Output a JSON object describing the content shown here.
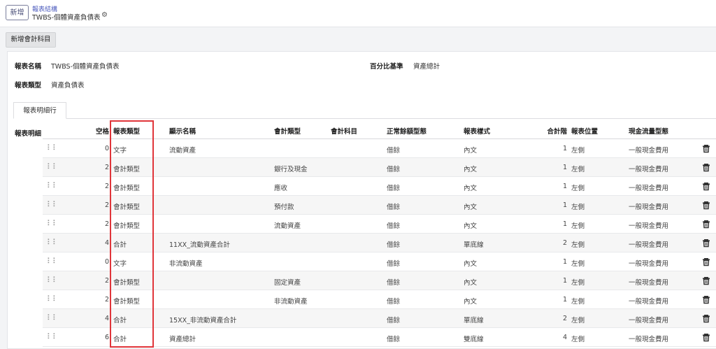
{
  "header": {
    "new_button": "新增",
    "breadcrumb": "報表結構",
    "subtitle": "TWBS-個體資產負債表"
  },
  "toolbar": {
    "add_account_button": "新增會計科目"
  },
  "form": {
    "report_name_label": "報表名稱",
    "report_name_value": "TWBS-個體資產負債表",
    "percent_base_label": "百分比基準",
    "percent_base_value": "資產總計",
    "report_type_label": "報表類型",
    "report_type_value": "資產負債表"
  },
  "tabs": [
    {
      "label": "報表明細行"
    }
  ],
  "detail_label": "報表明細",
  "columns": {
    "indent": "空格",
    "report_type": "報表類型",
    "display_name": "顯示名稱",
    "account_type": "會計類型",
    "account": "會計科目",
    "normal_balance": "正常餘額型態",
    "report_style": "報表樣式",
    "total_level": "合計階",
    "report_position": "報表位置",
    "cashflow_type": "現金流量型態"
  },
  "rows": [
    {
      "indent": "0",
      "report_type": "文字",
      "display_name": "流動資產",
      "account_type": "",
      "account": "",
      "normal_balance": "借餘",
      "report_style": "內文",
      "total_level": "1",
      "report_position": "左側",
      "cashflow_type": "一般現金費用"
    },
    {
      "indent": "2",
      "report_type": "會計類型",
      "display_name": "",
      "account_type": "銀行及現金",
      "account": "",
      "normal_balance": "借餘",
      "report_style": "內文",
      "total_level": "1",
      "report_position": "左側",
      "cashflow_type": "一般現金費用"
    },
    {
      "indent": "2",
      "report_type": "會計類型",
      "display_name": "",
      "account_type": "應收",
      "account": "",
      "normal_balance": "借餘",
      "report_style": "內文",
      "total_level": "1",
      "report_position": "左側",
      "cashflow_type": "一般現金費用"
    },
    {
      "indent": "2",
      "report_type": "會計類型",
      "display_name": "",
      "account_type": "預付款",
      "account": "",
      "normal_balance": "借餘",
      "report_style": "內文",
      "total_level": "1",
      "report_position": "左側",
      "cashflow_type": "一般現金費用"
    },
    {
      "indent": "2",
      "report_type": "會計類型",
      "display_name": "",
      "account_type": "流動資產",
      "account": "",
      "normal_balance": "借餘",
      "report_style": "內文",
      "total_level": "1",
      "report_position": "左側",
      "cashflow_type": "一般現金費用"
    },
    {
      "indent": "4",
      "report_type": "合計",
      "display_name": "11XX_流動資產合計",
      "account_type": "",
      "account": "",
      "normal_balance": "借餘",
      "report_style": "單底線",
      "total_level": "2",
      "report_position": "左側",
      "cashflow_type": "一般現金費用"
    },
    {
      "indent": "0",
      "report_type": "文字",
      "display_name": "非流動資產",
      "account_type": "",
      "account": "",
      "normal_balance": "借餘",
      "report_style": "內文",
      "total_level": "1",
      "report_position": "左側",
      "cashflow_type": "一般現金費用"
    },
    {
      "indent": "2",
      "report_type": "會計類型",
      "display_name": "",
      "account_type": "固定資產",
      "account": "",
      "normal_balance": "借餘",
      "report_style": "內文",
      "total_level": "1",
      "report_position": "左側",
      "cashflow_type": "一般現金費用"
    },
    {
      "indent": "2",
      "report_type": "會計類型",
      "display_name": "",
      "account_type": "非流動資產",
      "account": "",
      "normal_balance": "借餘",
      "report_style": "內文",
      "total_level": "1",
      "report_position": "左側",
      "cashflow_type": "一般現金費用"
    },
    {
      "indent": "4",
      "report_type": "合計",
      "display_name": "15XX_非流動資產合計",
      "account_type": "",
      "account": "",
      "normal_balance": "借餘",
      "report_style": "單底線",
      "total_level": "2",
      "report_position": "左側",
      "cashflow_type": "一般現金費用"
    },
    {
      "indent": "6",
      "report_type": "合計",
      "display_name": "資產總計",
      "account_type": "",
      "account": "",
      "normal_balance": "借餘",
      "report_style": "雙底線",
      "total_level": "4",
      "report_position": "左側",
      "cashflow_type": "一般現金費用"
    }
  ],
  "icons": {
    "settings": "gear-icon",
    "drag": "drag-handle-icon",
    "delete": "trash-icon"
  },
  "colors": {
    "highlight_box": "#e0353a",
    "breadcrumb_link": "#4c5bbd"
  }
}
